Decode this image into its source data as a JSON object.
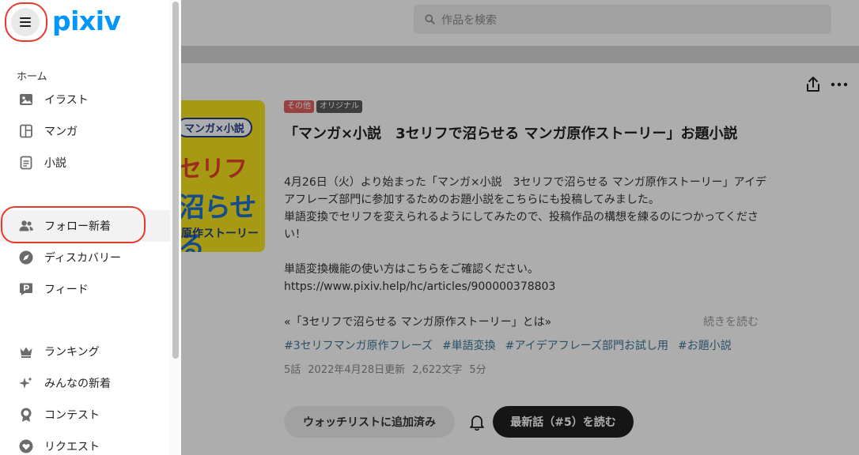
{
  "app": {
    "logo_text": "pixiv",
    "brand_color": "#0096fa"
  },
  "search": {
    "placeholder": "作品を検索",
    "icon": "search-icon"
  },
  "sidebar": {
    "menu_icon": "hamburger-menu-icon",
    "section_home": "ホーム",
    "items": [
      {
        "label": "イラスト",
        "icon": "illustration-icon"
      },
      {
        "label": "マンガ",
        "icon": "manga-icon"
      },
      {
        "label": "小説",
        "icon": "novel-icon"
      },
      {
        "label": "フォロー新着",
        "icon": "followers-icon",
        "active": true
      },
      {
        "label": "ディスカバリー",
        "icon": "compass-icon"
      },
      {
        "label": "フィード",
        "icon": "feed-icon"
      },
      {
        "label": "ランキング",
        "icon": "crown-icon"
      },
      {
        "label": "みんなの新着",
        "icon": "sparkle-icon"
      },
      {
        "label": "コンテスト",
        "icon": "medal-icon"
      },
      {
        "label": "リクエスト",
        "icon": "heart-icon"
      }
    ],
    "highlight_color": "#e8392d"
  },
  "work": {
    "cover": {
      "badge_line": "マンガ×小説",
      "line1": "セリフ",
      "line2": "沼らせる",
      "line3": "原作ストーリー"
    },
    "tags_badges": [
      {
        "label": "その他",
        "color": "#e0605f"
      },
      {
        "label": "オリジナル",
        "color": "#5b5b5b"
      }
    ],
    "title": "「マンガ×小説　3セリフで沼らせる マンガ原作ストーリー」お題小説",
    "description": [
      "4月26日（火）より始まった「マンガ×小説　3セリフで沼らせる マンガ原作ストーリー」アイデアフレーズ部門に参加するためのお題小説をこちらにも投稿してみました。",
      "単語変換でセリフを変えられるようにしてみたので、投稿作品の構想を練るのにつかってください！",
      "",
      "単語変換機能の使い方はこちらをご確認ください。",
      "https://www.pixiv.help/hc/articles/900000378803"
    ],
    "series_link": "«「3セリフで沼らせる マンガ原作ストーリー」とは»",
    "read_more": "続きを読む",
    "hashtags": [
      "#3セリフマンガ原作フレーズ",
      "#単語変換",
      "#アイデアフレーズ部門お試し用",
      "#お題小説"
    ],
    "meta": {
      "episodes": "5話",
      "updated": "2022年4月28日更新",
      "chars": "2,622文字",
      "minutes": "5分"
    },
    "watchlist_button": "ウォッチリストに追加済み",
    "latest_button": "最新話（#5）を読む"
  }
}
